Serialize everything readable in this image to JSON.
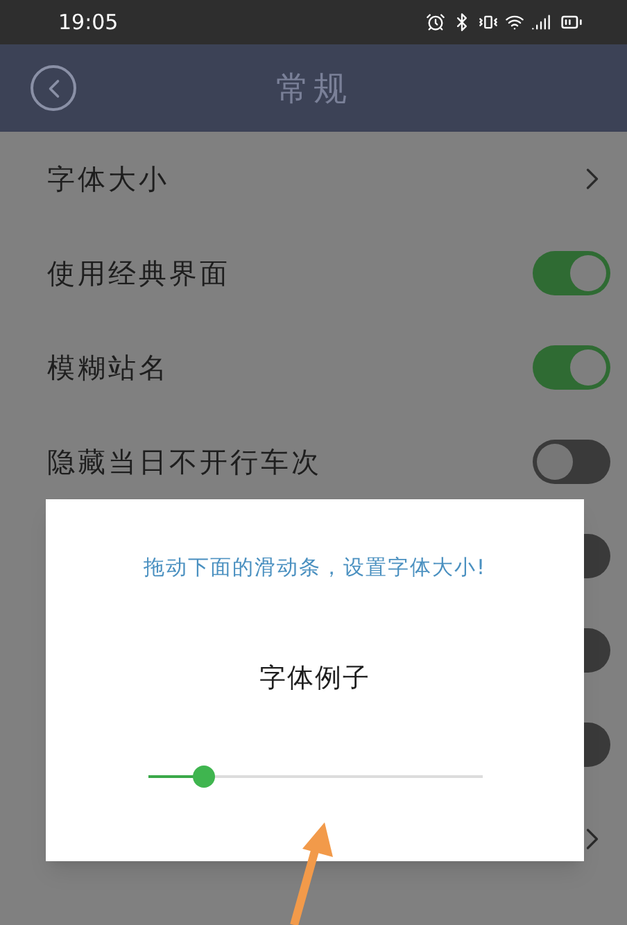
{
  "status_bar": {
    "time": "19:05"
  },
  "header": {
    "title": "常规"
  },
  "settings": [
    {
      "kind": "link",
      "label": "字体大小"
    },
    {
      "kind": "toggle",
      "label": "使用经典界面",
      "on": true
    },
    {
      "kind": "toggle",
      "label": "模糊站名",
      "on": true
    },
    {
      "kind": "toggle",
      "label": "隐藏当日不开行车次",
      "on": false
    },
    {
      "kind": "toggle",
      "on": false
    },
    {
      "kind": "toggle",
      "on": false
    },
    {
      "kind": "toggle",
      "on": false
    },
    {
      "kind": "link"
    }
  ],
  "dialog": {
    "message": "拖动下面的滑动条，设置字体大小!",
    "sample": "字体例子",
    "slider": {
      "level": 0.17
    }
  }
}
